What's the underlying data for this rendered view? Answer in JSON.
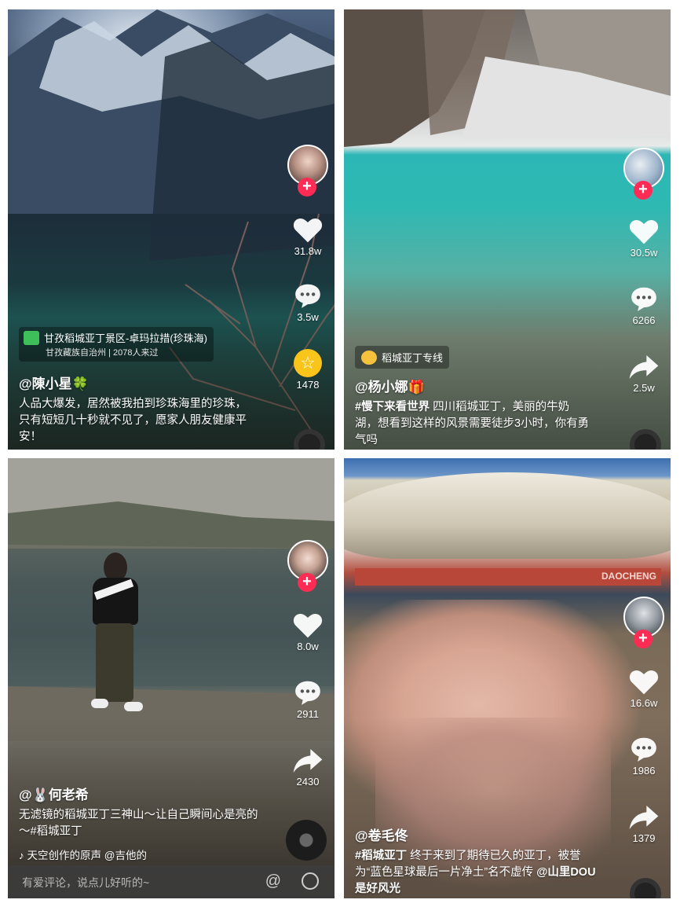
{
  "panels": [
    {
      "likes": "31.8w",
      "comments": "3.5w",
      "third": "1478",
      "location_title": "甘孜稻城亚丁景区-卓玛拉措(珍珠海)",
      "location_sub": "甘孜藏族自治州 | 2078人来过",
      "username": "@陳小星🍀",
      "caption": "人品大爆发，居然被我拍到珍珠海里的珍珠，只有短短几十秒就不见了，愿家人朋友健康平安！"
    },
    {
      "likes": "30.5w",
      "comments": "6266",
      "shares": "2.5w",
      "tag_label": "稻城亚丁专线",
      "username": "@杨小娜🎁",
      "hashtag": "#慢下来看世界",
      "caption": " 四川稻城亚丁，美丽的牛奶湖，想看到这样的风景需要徒步3小时，你有勇气吗"
    },
    {
      "likes": "8.0w",
      "comments": "2911",
      "shares": "2430",
      "username": "@🐰何老希",
      "caption": "无滤镜的稻城亚丁三神山～让自己瞬间心是亮的～#稻城亚丁",
      "music": "♪ 天空创作的原声    @吉他的",
      "comment_placeholder": "有爱评论，说点儿好听的~",
      "at_symbol": "@"
    },
    {
      "likes": "16.6w",
      "comments": "1986",
      "shares": "1379",
      "sign_text": "DAOCHENG",
      "username": "@卷毛佟",
      "hashtag": "#稻城亚丁",
      "caption": " 终于来到了期待已久的亚丁，被誉为“蓝色星球最后一片净土”名不虚传 ",
      "mention": "@山里DOU是好风光"
    }
  ],
  "icons": {
    "follow": "+",
    "star": "☆"
  }
}
